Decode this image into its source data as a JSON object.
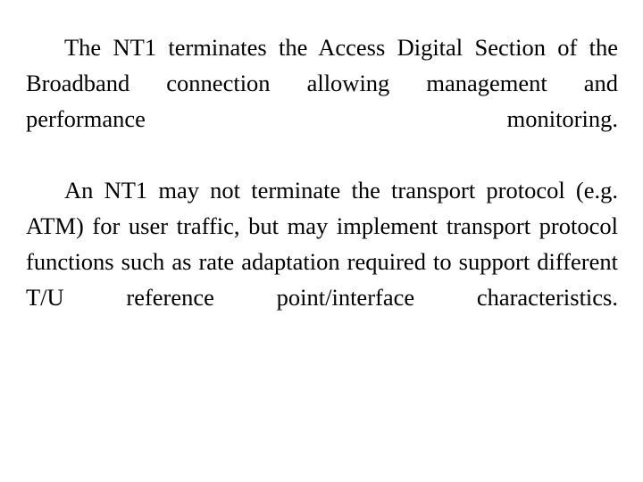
{
  "slide": {
    "background_color": "#ffffff",
    "text_color": "#000000",
    "body": {
      "paragraphs": [
        {
          "id": "paragraph-nt1-terminates",
          "text": "The NT1 terminates the Access Digital Section of the Broadband connection allowing management and performance monitoring.",
          "lines": [
            "The NT1 terminates the Access Digital Section",
            "of the Broadband connection allowing",
            "management and performance monitoring."
          ]
        },
        {
          "id": "paragraph-nt1-transport-protocol",
          "text": "An NT1 may not terminate the transport protocol (e.g. ATM) for user traffic, but may implement transport protocol functions such as rate adaptation required to support different T/U reference point/interface characteristics.",
          "lines": [
            "An NT1 may not terminate the transport",
            "protocol (e.g. ATM) for user traffic, but may",
            "implement transport protocol functions such as",
            "rate adaptation required to support different T/U",
            "reference point/interface characteristics."
          ]
        }
      ]
    }
  }
}
